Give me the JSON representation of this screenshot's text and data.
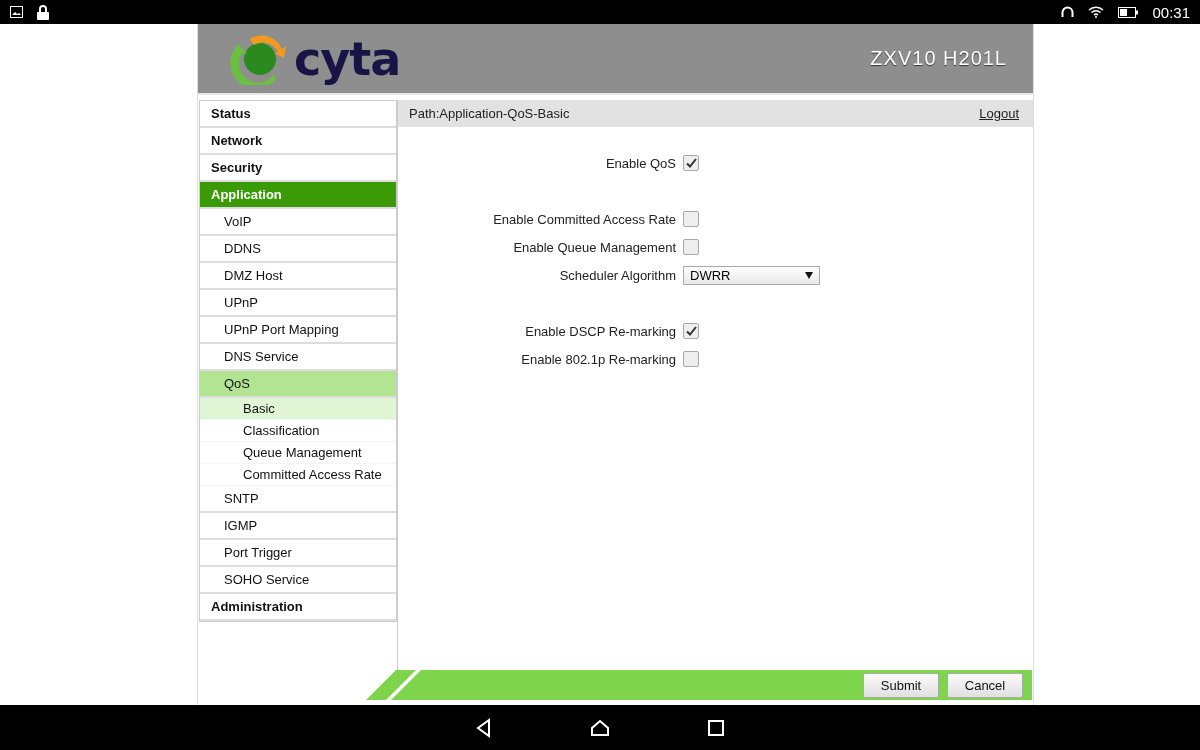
{
  "status_bar": {
    "time": "00:31"
  },
  "header": {
    "logo_text": "cyta",
    "model": "ZXV10 H201L"
  },
  "path_bar": {
    "path": "Path:Application-QoS-Basic",
    "logout": "Logout"
  },
  "sidebar": {
    "items": [
      {
        "label": "Status",
        "selected": false
      },
      {
        "label": "Network",
        "selected": false
      },
      {
        "label": "Security",
        "selected": false
      },
      {
        "label": "Application",
        "selected": true,
        "children": [
          {
            "label": "VoIP",
            "selected": false
          },
          {
            "label": "DDNS",
            "selected": false
          },
          {
            "label": "DMZ Host",
            "selected": false
          },
          {
            "label": "UPnP",
            "selected": false
          },
          {
            "label": "UPnP Port Mapping",
            "selected": false
          },
          {
            "label": "DNS Service",
            "selected": false
          },
          {
            "label": "QoS",
            "selected": true,
            "children": [
              {
                "label": "Basic",
                "selected": true
              },
              {
                "label": "Classification",
                "selected": false
              },
              {
                "label": "Queue Management",
                "selected": false
              },
              {
                "label": "Committed Access Rate",
                "selected": false
              }
            ]
          },
          {
            "label": "SNTP",
            "selected": false
          },
          {
            "label": "IGMP",
            "selected": false
          },
          {
            "label": "Port Trigger",
            "selected": false
          },
          {
            "label": "SOHO Service",
            "selected": false
          }
        ]
      },
      {
        "label": "Administration",
        "selected": false
      }
    ]
  },
  "form": {
    "groups": [
      [
        {
          "kind": "checkbox",
          "label": "Enable QoS",
          "checked": true
        }
      ],
      [
        {
          "kind": "checkbox",
          "label": "Enable Committed Access Rate",
          "checked": false
        },
        {
          "kind": "checkbox",
          "label": "Enable Queue Management",
          "checked": false
        },
        {
          "kind": "select",
          "label": "Scheduler Algorithm",
          "value": "DWRR"
        }
      ],
      [
        {
          "kind": "checkbox",
          "label": "Enable DSCP Re-marking",
          "checked": true
        },
        {
          "kind": "checkbox",
          "label": "Enable 802.1p Re-marking",
          "checked": false
        }
      ]
    ]
  },
  "buttons": [
    "Submit",
    "Cancel"
  ]
}
